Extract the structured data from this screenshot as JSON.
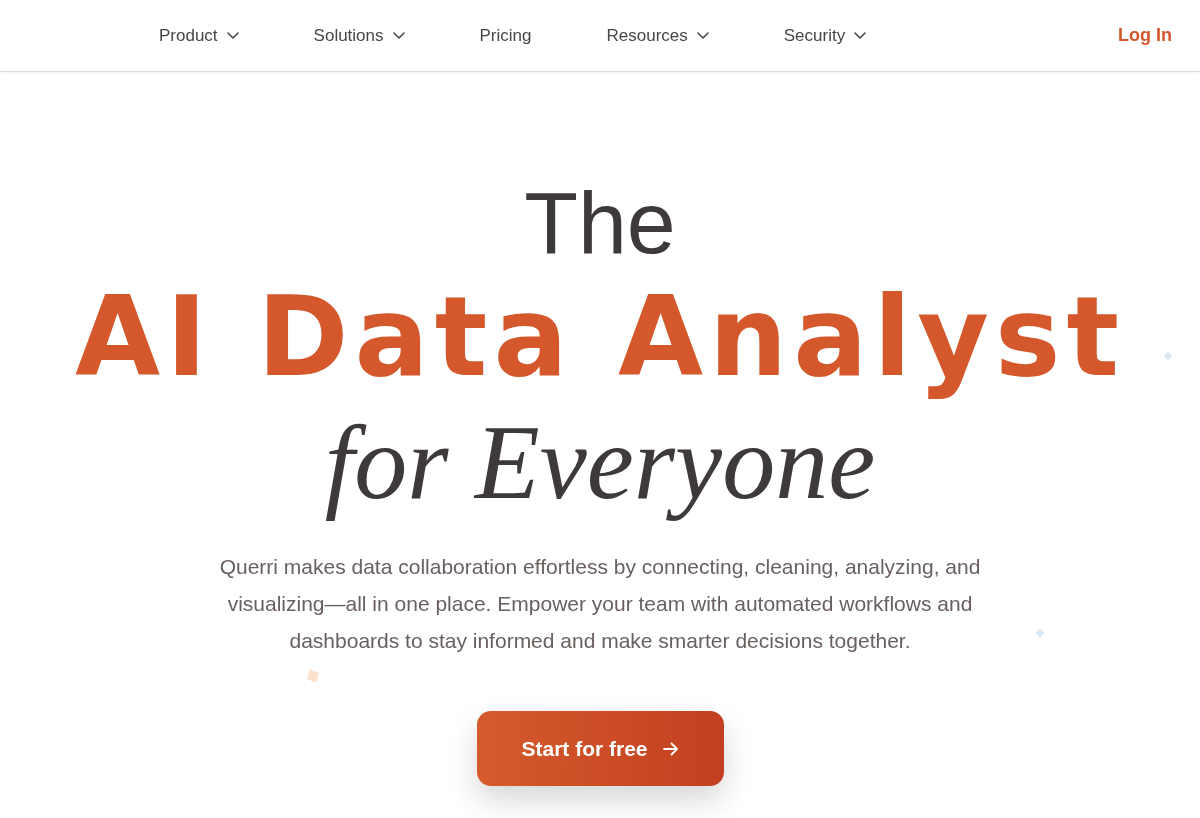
{
  "nav": {
    "items": [
      {
        "label": "Product",
        "kind": "dropdown"
      },
      {
        "label": "Solutions",
        "kind": "dropdown"
      },
      {
        "label": "Pricing",
        "kind": "link"
      },
      {
        "label": "Resources",
        "kind": "dropdown"
      },
      {
        "label": "Security",
        "kind": "dropdown"
      }
    ],
    "login": "Log In"
  },
  "hero": {
    "headline": [
      {
        "text": "The",
        "kind": "plain"
      },
      {
        "text": "AI Data Analyst",
        "kind": "accent"
      },
      {
        "text": "for Everyone",
        "kind": "script"
      }
    ],
    "description": "Querri makes data collaboration effortless by connecting, cleaning, analyzing, and visualizing—all in one place. Empower your team with automated workflows and dashboards to stay informed and make smarter decisions together.",
    "cta": {
      "label": "Start for free"
    }
  }
}
